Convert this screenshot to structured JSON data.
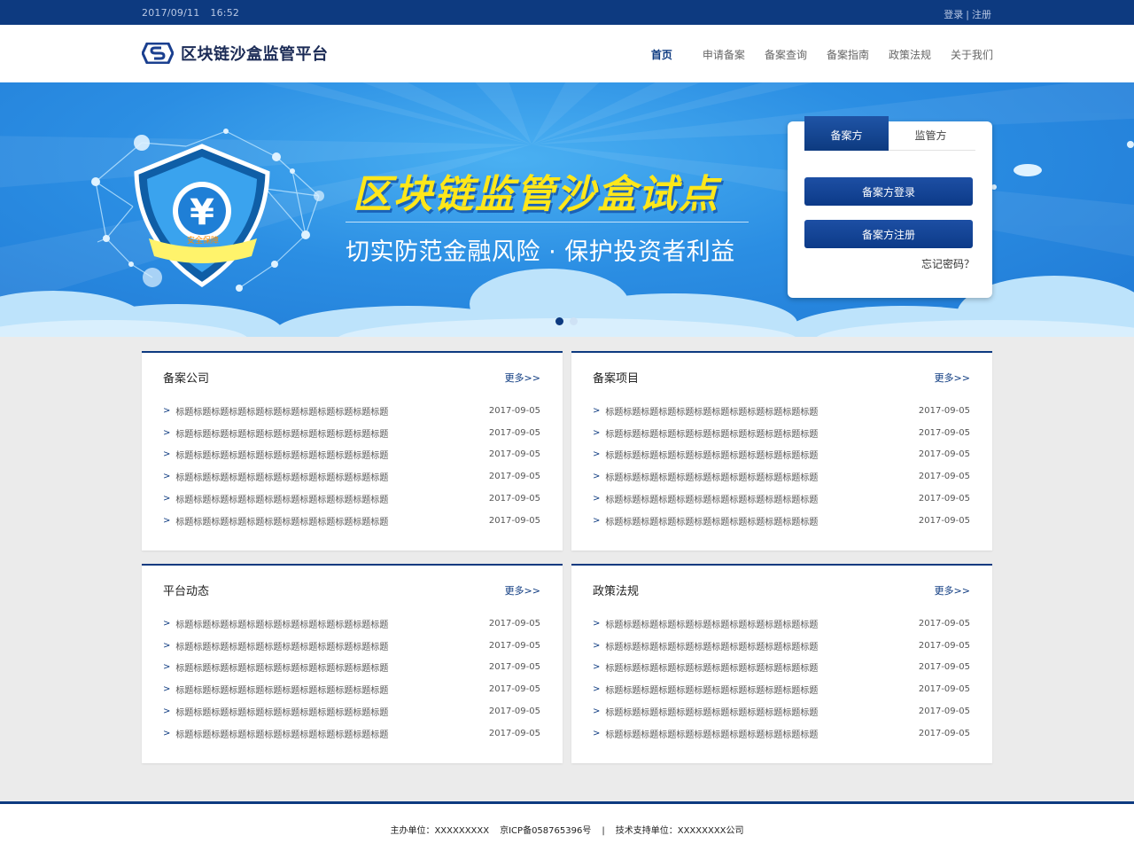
{
  "topbar": {
    "date": "2017/09/11",
    "time": "16:52",
    "login": "登录",
    "separator": "|",
    "register": "注册"
  },
  "header": {
    "site_name": "区块链沙盒监管平台",
    "nav": {
      "home": "首页",
      "apply": "申请备案",
      "query": "备案查询",
      "guide": "备案指南",
      "policy": "政策法规",
      "about": "关于我们"
    }
  },
  "banner": {
    "badge_text": "安全保障",
    "title": "区块链监管沙盒试点",
    "subtitle": "切实防范金融风险 · 保护投资者利益",
    "colors": {
      "accent": "#0d3a80",
      "title": "#ffe71a",
      "sky": "#2b8ee3"
    }
  },
  "login": {
    "tab_filer": "备案方",
    "tab_regulator": "监管方",
    "login_button": "备案方登录",
    "register_button": "备案方注册",
    "forgot": "忘记密码？"
  },
  "panels": [
    {
      "title": "备案公司",
      "more": "更多>>",
      "items": [
        {
          "arrow": ">",
          "title": "标题标题标题标题标题标题标题标题标题标题标题标题",
          "date": "2017-09-05"
        },
        {
          "arrow": ">",
          "title": "标题标题标题标题标题标题标题标题标题标题标题标题",
          "date": "2017-09-05"
        },
        {
          "arrow": ">",
          "title": "标题标题标题标题标题标题标题标题标题标题标题标题",
          "date": "2017-09-05"
        },
        {
          "arrow": ">",
          "title": "标题标题标题标题标题标题标题标题标题标题标题标题",
          "date": "2017-09-05"
        },
        {
          "arrow": ">",
          "title": "标题标题标题标题标题标题标题标题标题标题标题标题",
          "date": "2017-09-05"
        },
        {
          "arrow": ">",
          "title": "标题标题标题标题标题标题标题标题标题标题标题标题",
          "date": "2017-09-05"
        }
      ]
    },
    {
      "title": "备案项目",
      "more": "更多>>",
      "items": [
        {
          "arrow": ">",
          "title": "标题标题标题标题标题标题标题标题标题标题标题标题",
          "date": "2017-09-05"
        },
        {
          "arrow": ">",
          "title": "标题标题标题标题标题标题标题标题标题标题标题标题",
          "date": "2017-09-05"
        },
        {
          "arrow": ">",
          "title": "标题标题标题标题标题标题标题标题标题标题标题标题",
          "date": "2017-09-05"
        },
        {
          "arrow": ">",
          "title": "标题标题标题标题标题标题标题标题标题标题标题标题",
          "date": "2017-09-05"
        },
        {
          "arrow": ">",
          "title": "标题标题标题标题标题标题标题标题标题标题标题标题",
          "date": "2017-09-05"
        },
        {
          "arrow": ">",
          "title": "标题标题标题标题标题标题标题标题标题标题标题标题",
          "date": "2017-09-05"
        }
      ]
    },
    {
      "title": "平台动态",
      "more": "更多>>",
      "items": [
        {
          "arrow": ">",
          "title": "标题标题标题标题标题标题标题标题标题标题标题标题",
          "date": "2017-09-05"
        },
        {
          "arrow": ">",
          "title": "标题标题标题标题标题标题标题标题标题标题标题标题",
          "date": "2017-09-05"
        },
        {
          "arrow": ">",
          "title": "标题标题标题标题标题标题标题标题标题标题标题标题",
          "date": "2017-09-05"
        },
        {
          "arrow": ">",
          "title": "标题标题标题标题标题标题标题标题标题标题标题标题",
          "date": "2017-09-05"
        },
        {
          "arrow": ">",
          "title": "标题标题标题标题标题标题标题标题标题标题标题标题",
          "date": "2017-09-05"
        },
        {
          "arrow": ">",
          "title": "标题标题标题标题标题标题标题标题标题标题标题标题",
          "date": "2017-09-05"
        }
      ]
    },
    {
      "title": "政策法规",
      "more": "更多>>",
      "items": [
        {
          "arrow": ">",
          "title": "标题标题标题标题标题标题标题标题标题标题标题标题",
          "date": "2017-09-05"
        },
        {
          "arrow": ">",
          "title": "标题标题标题标题标题标题标题标题标题标题标题标题",
          "date": "2017-09-05"
        },
        {
          "arrow": ">",
          "title": "标题标题标题标题标题标题标题标题标题标题标题标题",
          "date": "2017-09-05"
        },
        {
          "arrow": ">",
          "title": "标题标题标题标题标题标题标题标题标题标题标题标题",
          "date": "2017-09-05"
        },
        {
          "arrow": ">",
          "title": "标题标题标题标题标题标题标题标题标题标题标题标题",
          "date": "2017-09-05"
        },
        {
          "arrow": ">",
          "title": "标题标题标题标题标题标题标题标题标题标题标题标题",
          "date": "2017-09-05"
        }
      ]
    }
  ],
  "footer": {
    "sponsor": "主办单位：XXXXXXXXX",
    "icp": "京ICP备058765396号",
    "separator": "|",
    "tech": "技术支持单位：XXXXXXXX公司"
  }
}
